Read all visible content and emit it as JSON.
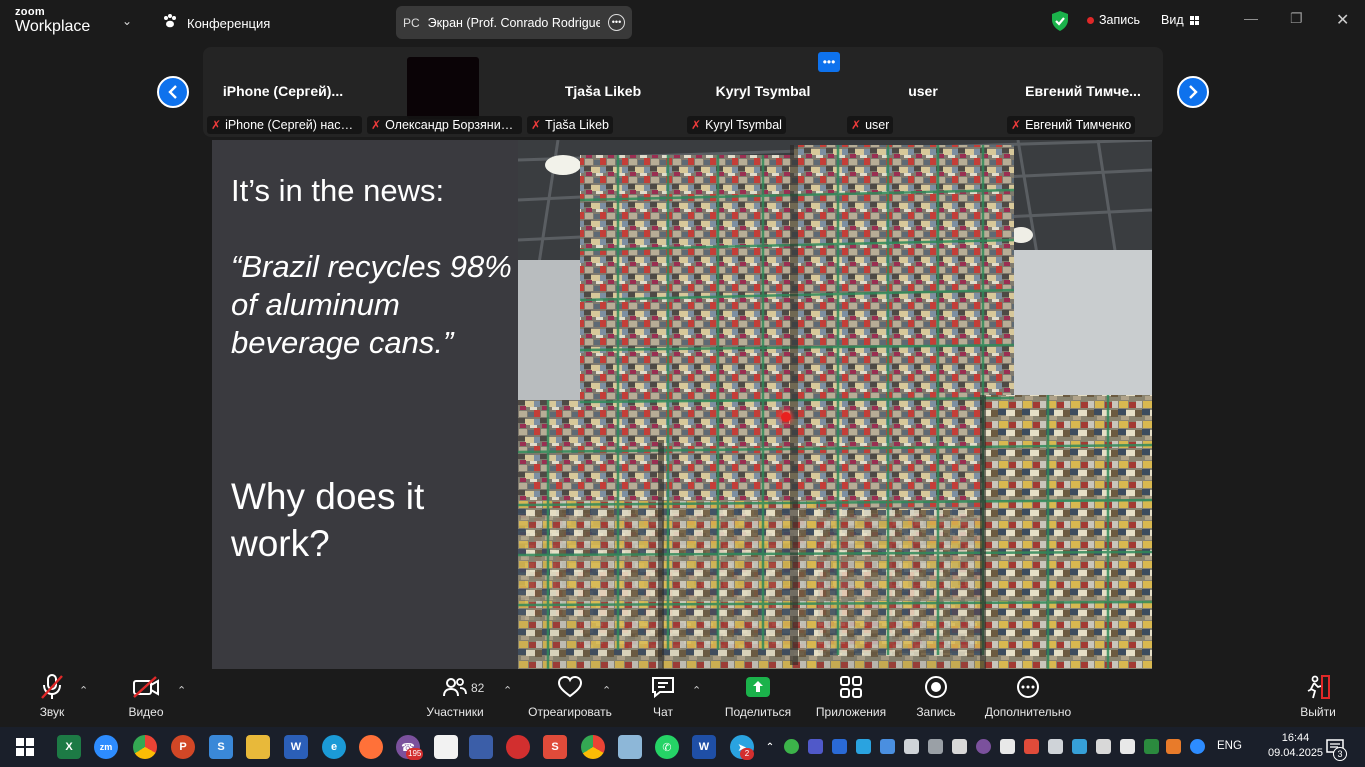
{
  "app": {
    "logo_top": "zoom",
    "logo_bottom": "Workplace",
    "meeting_label": "Конференция",
    "share_initials": "PC",
    "share_label": "Экран (Prof. Conrado Rodrigues",
    "recording_label": "Запись",
    "view_label": "Вид"
  },
  "participants": [
    {
      "big": "iPhone  (Сергей)...",
      "label": "iPhone (Сергей) насо...",
      "has_video": false
    },
    {
      "big": "",
      "label": "Олександр Борзяниц...",
      "has_video": true
    },
    {
      "big": "Tjaša Likeb",
      "label": "Tjaša Likeb",
      "has_video": false
    },
    {
      "big": "Kyryl Tsymbal",
      "label": "Kyryl Tsymbal",
      "has_video": false
    },
    {
      "big": "user",
      "label": "user",
      "has_video": false
    },
    {
      "big": "Евгений  Тимче...",
      "label": "Евгений Тимченко",
      "has_video": false
    }
  ],
  "slide": {
    "heading": "It’s in the news:",
    "quote": "“Brazil recycles 98% of aluminum beverage cans.”",
    "question": "Why does it work?"
  },
  "toolbar": {
    "audio": "Звук",
    "video": "Видео",
    "participants": "Участники",
    "participants_count": "82",
    "react": "Отреагировать",
    "chat": "Чат",
    "share": "Поделиться",
    "apps": "Приложения",
    "record": "Запись",
    "more": "Дополнительно",
    "leave": "Выйти"
  },
  "taskbar": {
    "viber_badge": "195",
    "telegram_badge": "2",
    "language": "ENG",
    "time": "16:44",
    "date": "09.04.2025",
    "notifications": "3"
  },
  "colors": {
    "accent": "#0e72ed",
    "share_green": "#1bb24b",
    "muted_red": "#e02828",
    "slide_panel": "#3a3a3f"
  }
}
